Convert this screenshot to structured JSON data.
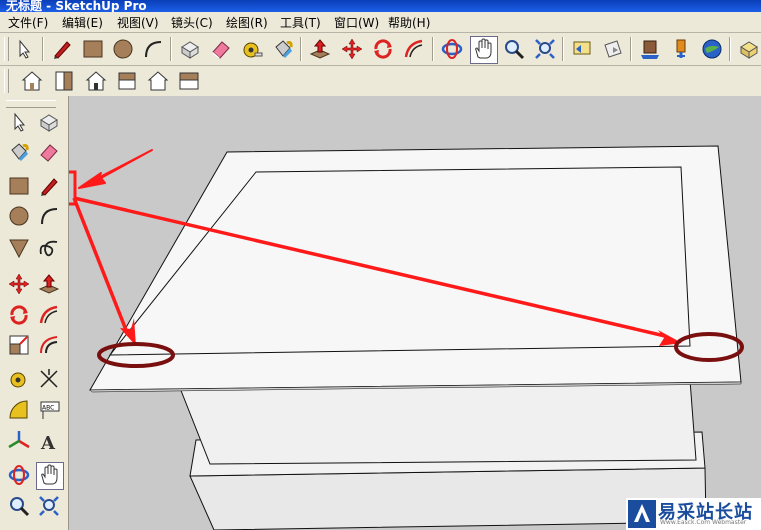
{
  "window": {
    "title": "无标题 - SketchUp Pro"
  },
  "menu": [
    {
      "label": "文件(F)"
    },
    {
      "label": "编辑(E)"
    },
    {
      "label": "视图(V)"
    },
    {
      "label": "镜头(C)"
    },
    {
      "label": "绘图(R)"
    },
    {
      "label": "工具(T)"
    },
    {
      "label": "窗口(W)"
    },
    {
      "label": "帮助(H)"
    }
  ],
  "toolbar_row1": [
    "select-icon",
    "pencil-icon",
    "rectangle-icon",
    "circle-icon",
    "arc-icon",
    "make-component-icon",
    "eraser-icon",
    "tape-measure-icon",
    "paint-bucket-icon",
    "push-pull-icon",
    "move-icon",
    "rotate-icon",
    "follow-me-icon",
    "orbit-icon",
    "pan-icon",
    "zoom-icon",
    "zoom-extents-icon",
    "previous-view-icon",
    "next-view-icon",
    "get-models-icon",
    "share-model-icon",
    "place-model-icon",
    "google-earth-icon",
    "components-icon"
  ],
  "toolbar_row2": [
    "iso-view-icon",
    "top-view-icon",
    "front-view-icon",
    "right-view-icon",
    "back-view-icon",
    "left-view-icon"
  ],
  "left_toolbar": [
    "select-icon",
    "make-component-icon",
    "paint-bucket-icon",
    "eraser-icon",
    "rectangle-icon",
    "pencil-icon",
    "circle-icon",
    "arc-icon",
    "polygon-icon",
    "freehand-icon",
    "move-icon",
    "push-pull-icon",
    "rotate-icon",
    "follow-me-icon",
    "scale-icon",
    "offset-icon",
    "tape-measure-icon",
    "dimension-icon",
    "protractor-icon",
    "text-icon",
    "axes-icon",
    "3d-text-icon",
    "orbit-icon",
    "pan-icon",
    "zoom-icon",
    "zoom-window-icon"
  ],
  "colors": {
    "annotation_red": "#ff1a1a",
    "ellipse_dark": "#7a0f0f",
    "viewport_bg": "#c9c9c9",
    "watermark_blue": "#1b4d9e"
  },
  "watermark": {
    "text": "易采站长站",
    "url": "Www.Easck.Com Webmaster"
  }
}
